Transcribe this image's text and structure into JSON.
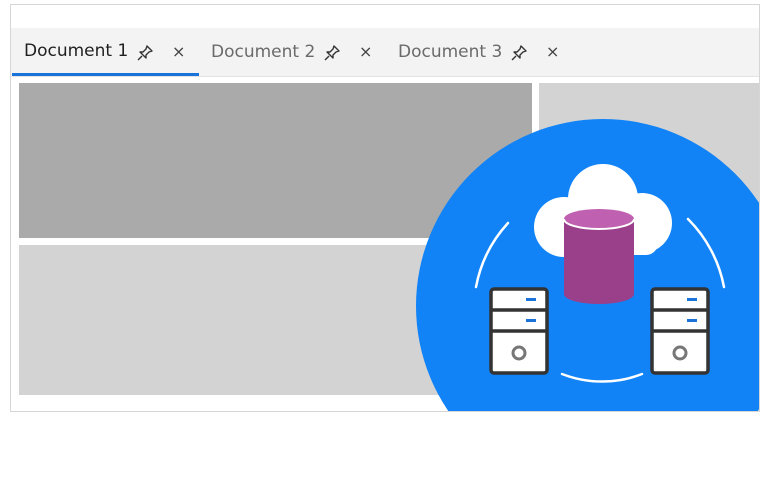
{
  "tabs": [
    {
      "label": "Document 1",
      "active": true,
      "pin_icon": "pin-icon",
      "close_glyph": "×"
    },
    {
      "label": "Document 2",
      "active": false,
      "pin_icon": "pin-icon",
      "close_glyph": "×"
    },
    {
      "label": "Document 3",
      "active": false,
      "pin_icon": "pin-icon",
      "close_glyph": "×"
    }
  ],
  "colors": {
    "accent": "#1a73d9",
    "pane_dark": "#aaaaaa",
    "pane_light": "#d3d3d3",
    "badge_blue": "#1183f7",
    "database_purple": "#9a3f8a"
  },
  "illustration": {
    "icons": [
      "cloud-icon",
      "database-icon",
      "server-icon",
      "server-icon"
    ]
  }
}
